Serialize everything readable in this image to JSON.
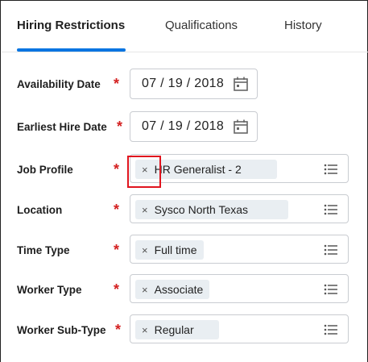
{
  "tabs": [
    {
      "label": "Hiring Restrictions",
      "active": true
    },
    {
      "label": "Qualifications",
      "active": false
    },
    {
      "label": "History",
      "active": false
    }
  ],
  "accent_color": "#0875e1",
  "required_color": "#d42121",
  "highlight_color": "#e0141e",
  "required_marker": "*",
  "remove_glyph": "×",
  "form": {
    "availability_date": {
      "label": "Availability Date",
      "value": "07 / 19 / 2018",
      "icon": "calendar-icon"
    },
    "earliest_hire_date": {
      "label": "Earliest Hire Date",
      "value": "07 / 19 / 2018",
      "icon": "calendar-icon"
    },
    "job_profile": {
      "label": "Job Profile",
      "value": "HR Generalist - 2",
      "icon": "list-icon"
    },
    "location": {
      "label": "Location",
      "value": "Sysco North Texas",
      "icon": "list-icon"
    },
    "time_type": {
      "label": "Time Type",
      "value": "Full time",
      "icon": "list-icon"
    },
    "worker_type": {
      "label": "Worker Type",
      "value": "Associate",
      "icon": "list-icon"
    },
    "worker_sub_type": {
      "label": "Worker Sub-Type",
      "value": "Regular",
      "icon": "list-icon"
    }
  }
}
